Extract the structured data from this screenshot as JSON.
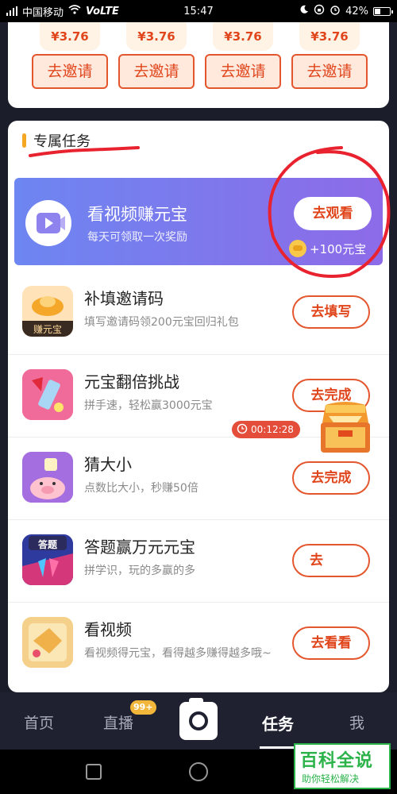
{
  "status_bar": {
    "carrier": "中国移动",
    "network": "VoLTE",
    "time": "15:47",
    "battery": "42%",
    "battery_level": 0.42
  },
  "invite_cards": [
    {
      "amount": "¥3.76",
      "button": "去邀请"
    },
    {
      "amount": "¥3.76",
      "button": "去邀请"
    },
    {
      "amount": "¥3.76",
      "button": "去邀请"
    },
    {
      "amount": "¥3.76",
      "button": "去邀请"
    }
  ],
  "exclusive": {
    "section_title": "专属任务",
    "banner": {
      "title": "看视频赚元宝",
      "subtitle": "每天可领取一次奖励",
      "button": "去观看",
      "reward": "+100元宝"
    },
    "tasks": [
      {
        "title": "补填邀请码",
        "desc": "填写邀请码领200元宝回归礼包",
        "button": "去填写",
        "icon": "gold-ingot-icon",
        "icon_caption": "赚元宝"
      },
      {
        "title": "元宝翻倍挑战",
        "desc": "拼手速，轻松赢3000元宝",
        "button": "去完成",
        "icon": "lipstick-icon"
      },
      {
        "title": "猜大小",
        "desc": "点数比大小，秒赚50倍",
        "button": "去完成",
        "icon": "pig-dice-icon"
      },
      {
        "title": "答题赢万元元宝",
        "desc": "拼学识，玩的多赢的多",
        "button": "去",
        "icon": "quiz-vs-icon",
        "icon_caption": "答题"
      },
      {
        "title": "看视频",
        "desc": "看视频得元宝，看得越多赚得越多哦~",
        "button": "去看看",
        "icon": "video-gold-icon"
      }
    ]
  },
  "floating": {
    "timer": "00:12:28",
    "icon": "treasure-chest-icon"
  },
  "bottom_nav": {
    "items": [
      "首页",
      "直播",
      "任务",
      "我"
    ],
    "active": "任务",
    "live_badge": "99+"
  },
  "watermark": {
    "main": "百科全说",
    "sub": "助你轻松解决"
  },
  "colors": {
    "accent": "#e4572e",
    "banner_start": "#6d86f1",
    "banner_end": "#8d6be8",
    "annotation": "#e8222e",
    "watermark_green": "#2bb34a"
  }
}
